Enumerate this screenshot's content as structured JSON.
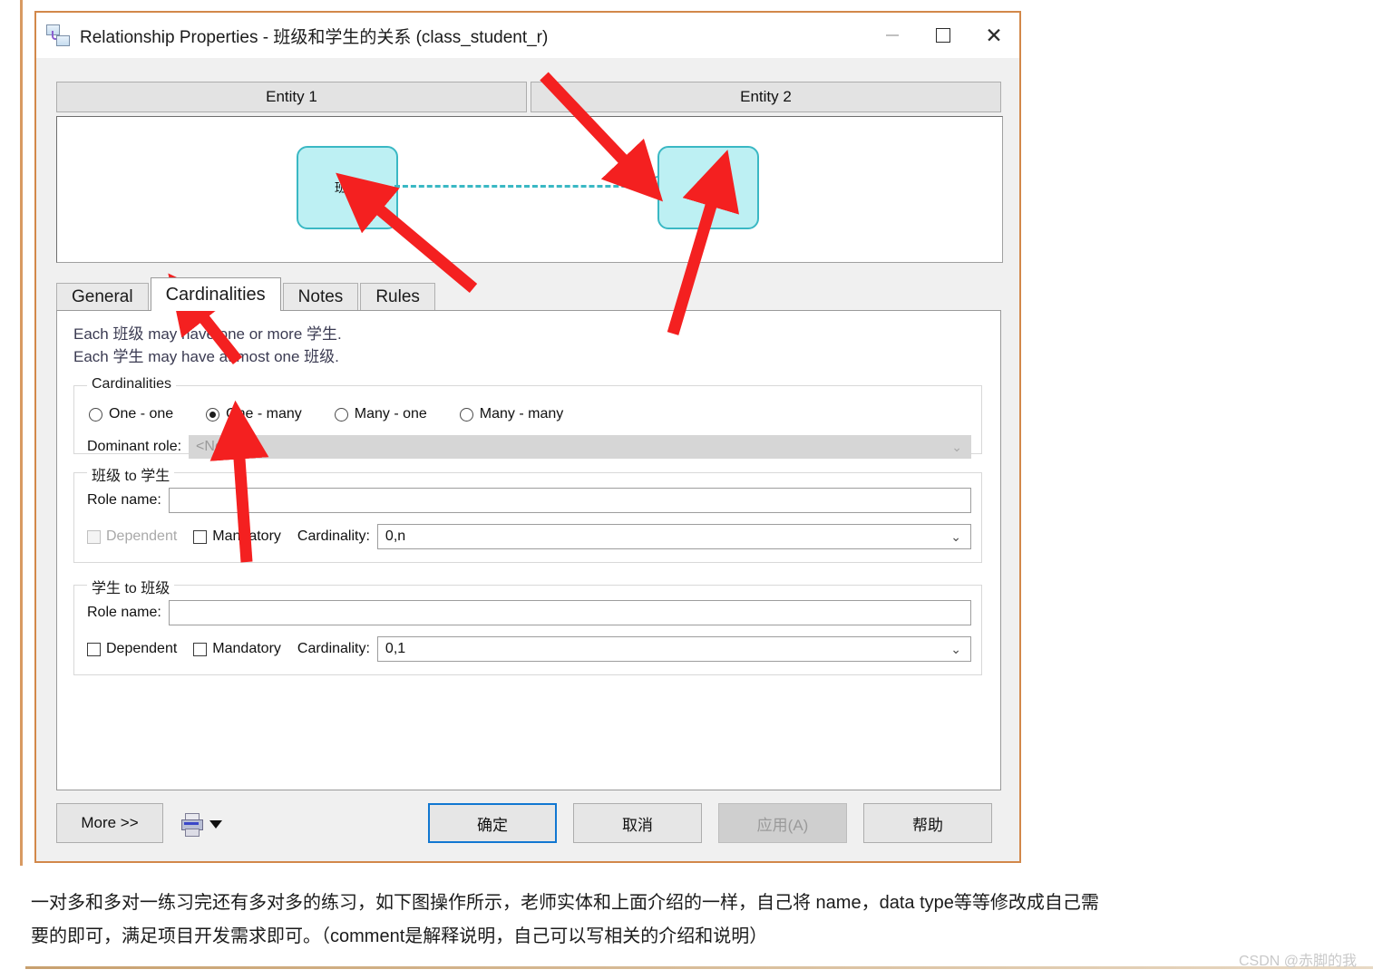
{
  "window": {
    "title": "Relationship Properties - 班级和学生的关系 (class_student_r)",
    "icon": "relationship-icon",
    "controls": {
      "minimize": "—",
      "maximize": "☐",
      "close": "✕"
    }
  },
  "entity_headers": {
    "entity1": "Entity 1",
    "entity2": "Entity 2"
  },
  "diagram": {
    "left_entity": "班级",
    "right_entity": "学生",
    "link_style": "dashed",
    "link_color": "#3ab8c4",
    "terminator": "crow-foot"
  },
  "tabs": [
    {
      "label": "General",
      "active": false
    },
    {
      "label": "Cardinalities",
      "active": true
    },
    {
      "label": "Notes",
      "active": false
    },
    {
      "label": "Rules",
      "active": false
    }
  ],
  "description": {
    "line1": "Each 班级 may have one or more 学生.",
    "line2": "Each 学生 may have at most one 班级."
  },
  "cardinalities_group": {
    "legend": "Cardinalities",
    "options": [
      {
        "label": "One - one",
        "selected": false
      },
      {
        "label": "One - many",
        "selected": true
      },
      {
        "label": "Many - one",
        "selected": false
      },
      {
        "label": "Many - many",
        "selected": false
      }
    ],
    "dominant_role": {
      "label": "Dominant role:",
      "value": "<None>",
      "disabled": true,
      "chevron": "⌄"
    }
  },
  "class_to_student": {
    "legend": "班级 to 学生",
    "role_name_label": "Role name:",
    "role_name_value": "",
    "dependent_label": "Dependent",
    "dependent_disabled": true,
    "mandatory_label": "Mandatory",
    "cardinality_label": "Cardinality:",
    "cardinality_value": "0,n",
    "chevron": "⌄"
  },
  "student_to_class": {
    "legend": "学生 to 班级",
    "role_name_label": "Role name:",
    "role_name_value": "",
    "dependent_label": "Dependent",
    "dependent_disabled": false,
    "mandatory_label": "Mandatory",
    "cardinality_label": "Cardinality:",
    "cardinality_value": "0,1",
    "chevron": "⌄"
  },
  "buttons": {
    "more": "More >>",
    "print_icon": "printer-icon",
    "ok": "确定",
    "cancel": "取消",
    "apply": "应用(A)",
    "help": "帮助"
  },
  "caption": {
    "line1": "一对多和多对一练习完还有多对多的练习，如下图操作所示，老师实体和上面介绍的一样，自己将 name，data type等等修改成自己需",
    "line2": "要的即可，满足项目开发需求即可。（comment是解释说明，自己可以写相关的介绍和说明）"
  },
  "watermark": "CSDN @赤脚的我",
  "colors": {
    "accent_border": "#d2884a",
    "entity_fill": "#bdf0f3",
    "entity_stroke": "#3ab8c4",
    "annotation_arrow": "#f42020",
    "default_button_border": "#1177d1"
  }
}
